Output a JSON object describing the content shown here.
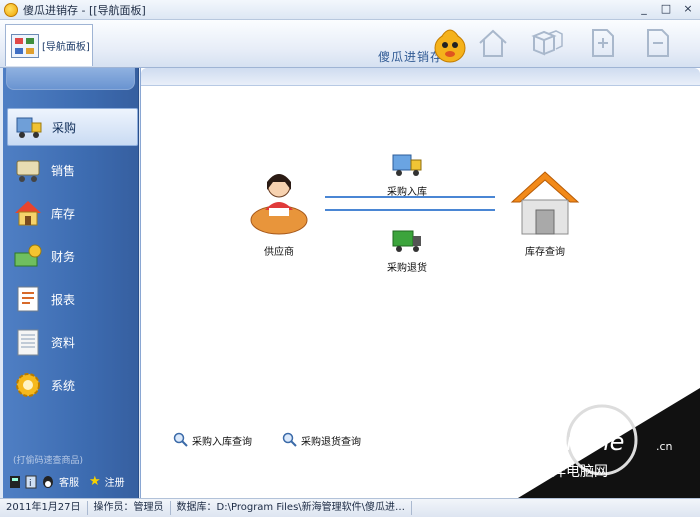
{
  "window": {
    "title": "傻瓜进销存 - [[导航面板]",
    "minimize": "_",
    "maximize": "□",
    "close": "×"
  },
  "toolbar": {
    "tab_label": "[导航面板]",
    "brand": "傻瓜进销存"
  },
  "sidebar": {
    "items": [
      {
        "label": "采购",
        "icon": "truck-icon",
        "active": true
      },
      {
        "label": "销售",
        "icon": "cart-icon"
      },
      {
        "label": "库存",
        "icon": "house-icon"
      },
      {
        "label": "财务",
        "icon": "money-icon"
      },
      {
        "label": "报表",
        "icon": "report-icon"
      },
      {
        "label": "资料",
        "icon": "document-icon"
      },
      {
        "label": "系统",
        "icon": "gear-icon"
      }
    ],
    "hint": "(打偷码速查商品)",
    "support": "客服",
    "register": "注册"
  },
  "flow": {
    "supplier": "供应商",
    "warehouse": "库存查询",
    "purchase_in": "采购入库",
    "purchase_return": "采购退货"
  },
  "queries": {
    "in_query": "采购入库查询",
    "return_query": "采购退货查询"
  },
  "status": {
    "date": "2011年1月27日",
    "operator": "操作员：管理员",
    "database": "数据库：D:\\Program  Files\\新海管理软件\\傻瓜进…"
  },
  "watermark": {
    "brand": "PConline",
    "domain": ".cn",
    "subtitle": "太平洋电脑网"
  }
}
